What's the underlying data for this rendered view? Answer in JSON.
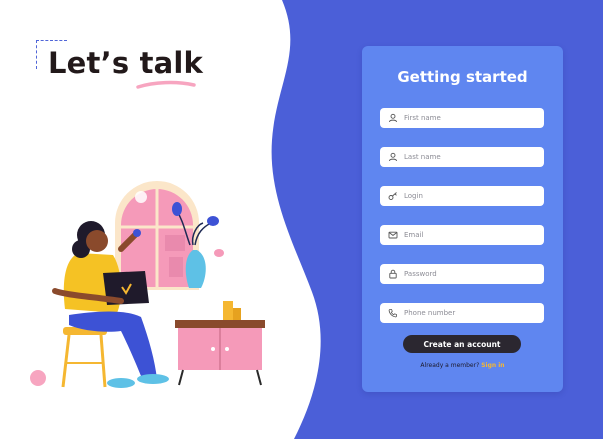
{
  "hero": {
    "title": "Let’s talk"
  },
  "form": {
    "title": "Getting started",
    "fields": [
      {
        "placeholder": "First name",
        "icon": "user-icon"
      },
      {
        "placeholder": "Last name",
        "icon": "user-icon"
      },
      {
        "placeholder": "Login",
        "icon": "key-icon"
      },
      {
        "placeholder": "Email",
        "icon": "mail-icon"
      },
      {
        "placeholder": "Password",
        "icon": "lock-icon"
      },
      {
        "placeholder": "Phone number",
        "icon": "phone-icon"
      }
    ],
    "submit_label": "Create an account",
    "member_prompt": "Already a member?",
    "signin_label": "Sign in"
  },
  "colors": {
    "background": "#ffffff",
    "wave": "#4b5fd8",
    "card": "#5f86f0",
    "button": "#2b2730",
    "link": "#f5b731",
    "title_text": "#22191a"
  }
}
